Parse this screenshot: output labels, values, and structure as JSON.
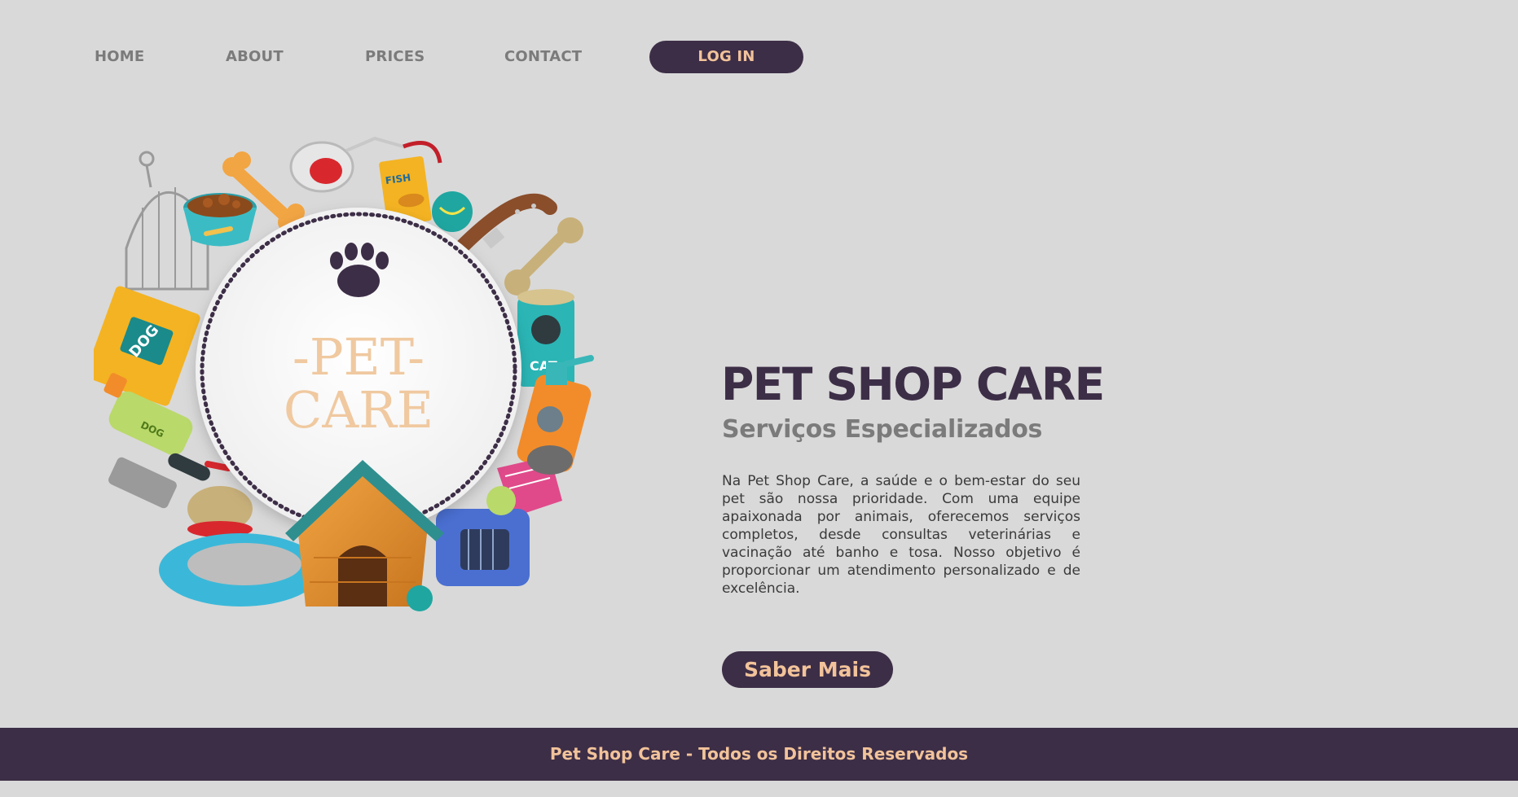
{
  "nav": {
    "items": [
      {
        "label": "HOME"
      },
      {
        "label": "ABOUT"
      },
      {
        "label": "PRICES"
      },
      {
        "label": "CONTACT"
      }
    ],
    "login_label": "LOG IN"
  },
  "hero": {
    "badge_line1": "-PET-",
    "badge_line2": "CARE",
    "package_label_dog": "DOG",
    "package_label_fish": "FISH",
    "package_label_cat": "CAT",
    "bottle_label_dog": "DOG"
  },
  "content": {
    "title": "PET SHOP CARE",
    "subtitle": "Serviços Especializados",
    "description": "Na Pet Shop Care, a saúde e o bem-estar do seu pet são nossa prioridade. Com uma equipe apaixonada por animais, oferecemos serviços completos, desde consultas veterinárias e vacinação até banho e tosa. Nosso objetivo é proporcionar um atendimento personalizado e de excelência.",
    "cta_label": "Saber Mais"
  },
  "footer": {
    "text": "Pet Shop Care - Todos os Direitos Reservados"
  },
  "colors": {
    "background": "#d9d9d9",
    "primary": "#3d2e47",
    "accent": "#f2c39a",
    "muted_text": "#7b7b7b"
  },
  "icons": {
    "badge_icon": "paw-icon"
  }
}
